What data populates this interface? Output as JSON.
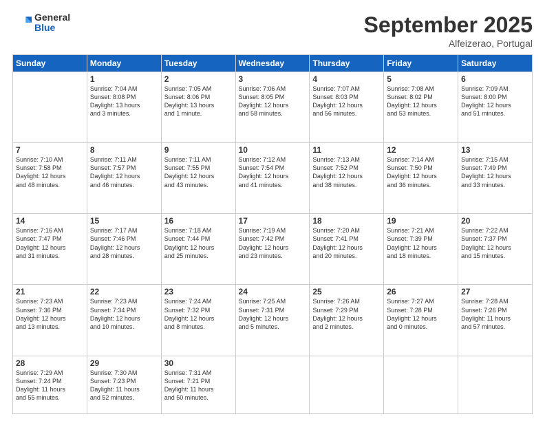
{
  "header": {
    "logo": {
      "line1": "General",
      "line2": "Blue"
    },
    "title": "September 2025",
    "location": "Alfeizerao, Portugal"
  },
  "weekdays": [
    "Sunday",
    "Monday",
    "Tuesday",
    "Wednesday",
    "Thursday",
    "Friday",
    "Saturday"
  ],
  "weeks": [
    {
      "days": [
        {
          "num": "",
          "info": ""
        },
        {
          "num": "1",
          "info": "Sunrise: 7:04 AM\nSunset: 8:08 PM\nDaylight: 13 hours\nand 3 minutes."
        },
        {
          "num": "2",
          "info": "Sunrise: 7:05 AM\nSunset: 8:06 PM\nDaylight: 13 hours\nand 1 minute."
        },
        {
          "num": "3",
          "info": "Sunrise: 7:06 AM\nSunset: 8:05 PM\nDaylight: 12 hours\nand 58 minutes."
        },
        {
          "num": "4",
          "info": "Sunrise: 7:07 AM\nSunset: 8:03 PM\nDaylight: 12 hours\nand 56 minutes."
        },
        {
          "num": "5",
          "info": "Sunrise: 7:08 AM\nSunset: 8:02 PM\nDaylight: 12 hours\nand 53 minutes."
        },
        {
          "num": "6",
          "info": "Sunrise: 7:09 AM\nSunset: 8:00 PM\nDaylight: 12 hours\nand 51 minutes."
        }
      ]
    },
    {
      "days": [
        {
          "num": "7",
          "info": "Sunrise: 7:10 AM\nSunset: 7:58 PM\nDaylight: 12 hours\nand 48 minutes."
        },
        {
          "num": "8",
          "info": "Sunrise: 7:11 AM\nSunset: 7:57 PM\nDaylight: 12 hours\nand 46 minutes."
        },
        {
          "num": "9",
          "info": "Sunrise: 7:11 AM\nSunset: 7:55 PM\nDaylight: 12 hours\nand 43 minutes."
        },
        {
          "num": "10",
          "info": "Sunrise: 7:12 AM\nSunset: 7:54 PM\nDaylight: 12 hours\nand 41 minutes."
        },
        {
          "num": "11",
          "info": "Sunrise: 7:13 AM\nSunset: 7:52 PM\nDaylight: 12 hours\nand 38 minutes."
        },
        {
          "num": "12",
          "info": "Sunrise: 7:14 AM\nSunset: 7:50 PM\nDaylight: 12 hours\nand 36 minutes."
        },
        {
          "num": "13",
          "info": "Sunrise: 7:15 AM\nSunset: 7:49 PM\nDaylight: 12 hours\nand 33 minutes."
        }
      ]
    },
    {
      "days": [
        {
          "num": "14",
          "info": "Sunrise: 7:16 AM\nSunset: 7:47 PM\nDaylight: 12 hours\nand 31 minutes."
        },
        {
          "num": "15",
          "info": "Sunrise: 7:17 AM\nSunset: 7:46 PM\nDaylight: 12 hours\nand 28 minutes."
        },
        {
          "num": "16",
          "info": "Sunrise: 7:18 AM\nSunset: 7:44 PM\nDaylight: 12 hours\nand 25 minutes."
        },
        {
          "num": "17",
          "info": "Sunrise: 7:19 AM\nSunset: 7:42 PM\nDaylight: 12 hours\nand 23 minutes."
        },
        {
          "num": "18",
          "info": "Sunrise: 7:20 AM\nSunset: 7:41 PM\nDaylight: 12 hours\nand 20 minutes."
        },
        {
          "num": "19",
          "info": "Sunrise: 7:21 AM\nSunset: 7:39 PM\nDaylight: 12 hours\nand 18 minutes."
        },
        {
          "num": "20",
          "info": "Sunrise: 7:22 AM\nSunset: 7:37 PM\nDaylight: 12 hours\nand 15 minutes."
        }
      ]
    },
    {
      "days": [
        {
          "num": "21",
          "info": "Sunrise: 7:23 AM\nSunset: 7:36 PM\nDaylight: 12 hours\nand 13 minutes."
        },
        {
          "num": "22",
          "info": "Sunrise: 7:23 AM\nSunset: 7:34 PM\nDaylight: 12 hours\nand 10 minutes."
        },
        {
          "num": "23",
          "info": "Sunrise: 7:24 AM\nSunset: 7:32 PM\nDaylight: 12 hours\nand 8 minutes."
        },
        {
          "num": "24",
          "info": "Sunrise: 7:25 AM\nSunset: 7:31 PM\nDaylight: 12 hours\nand 5 minutes."
        },
        {
          "num": "25",
          "info": "Sunrise: 7:26 AM\nSunset: 7:29 PM\nDaylight: 12 hours\nand 2 minutes."
        },
        {
          "num": "26",
          "info": "Sunrise: 7:27 AM\nSunset: 7:28 PM\nDaylight: 12 hours\nand 0 minutes."
        },
        {
          "num": "27",
          "info": "Sunrise: 7:28 AM\nSunset: 7:26 PM\nDaylight: 11 hours\nand 57 minutes."
        }
      ]
    },
    {
      "days": [
        {
          "num": "28",
          "info": "Sunrise: 7:29 AM\nSunset: 7:24 PM\nDaylight: 11 hours\nand 55 minutes."
        },
        {
          "num": "29",
          "info": "Sunrise: 7:30 AM\nSunset: 7:23 PM\nDaylight: 11 hours\nand 52 minutes."
        },
        {
          "num": "30",
          "info": "Sunrise: 7:31 AM\nSunset: 7:21 PM\nDaylight: 11 hours\nand 50 minutes."
        },
        {
          "num": "",
          "info": ""
        },
        {
          "num": "",
          "info": ""
        },
        {
          "num": "",
          "info": ""
        },
        {
          "num": "",
          "info": ""
        }
      ]
    }
  ]
}
